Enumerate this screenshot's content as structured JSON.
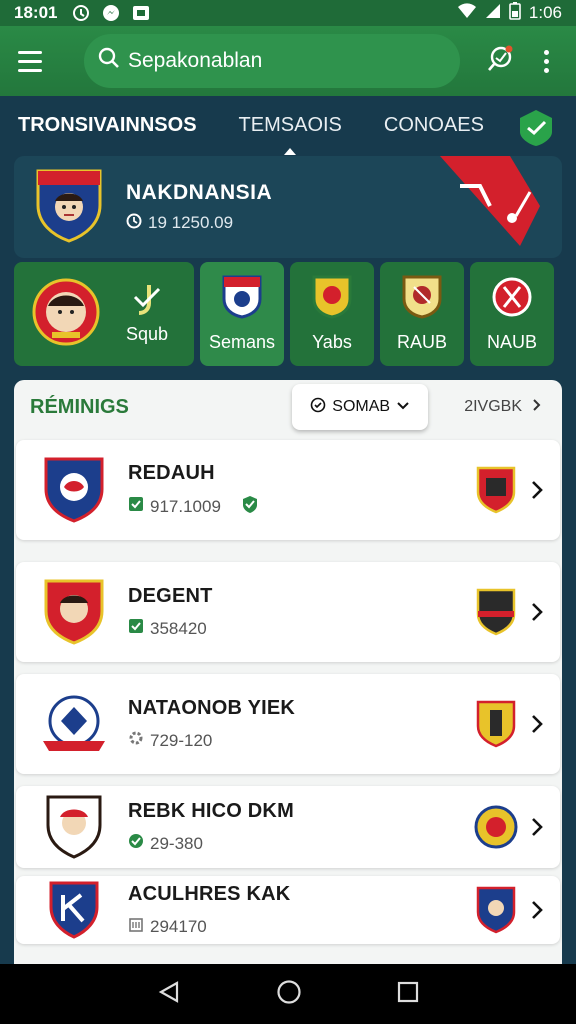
{
  "status_bar": {
    "time": "18:01",
    "clock_right": "1:06"
  },
  "app_bar": {
    "search_value": "Sepakonablan"
  },
  "tabs": [
    {
      "label": "TRONSIVAINNSOS",
      "active": true
    },
    {
      "label": "TEMSAOIS",
      "active": false
    },
    {
      "label": "CONOAES",
      "active": false
    }
  ],
  "featured": {
    "title": "NAKDNANSIA",
    "meta": "19 1250.09"
  },
  "categories": [
    {
      "label": "Squb"
    },
    {
      "label": "Semans"
    },
    {
      "label": "Yabs"
    },
    {
      "label": "RAUB"
    },
    {
      "label": "NAUB"
    }
  ],
  "list": {
    "title": "RÉMINIGS",
    "filter_label": "SOMAB",
    "sort_label": "2IVGBK",
    "rows": [
      {
        "name": "REDAUH",
        "meta": "917.1009"
      },
      {
        "name": "DEGENT",
        "meta": "358420"
      },
      {
        "name": "NATAONOB YIEK",
        "meta": "729-120"
      },
      {
        "name": "REBK HICO DKM",
        "meta": "29-380"
      },
      {
        "name": "ACULHRES KAK",
        "meta": "294170"
      }
    ]
  },
  "colors": {
    "brand_green": "#23773c",
    "accent_red": "#d3202c",
    "panel_bg": "#f3f5f4"
  }
}
